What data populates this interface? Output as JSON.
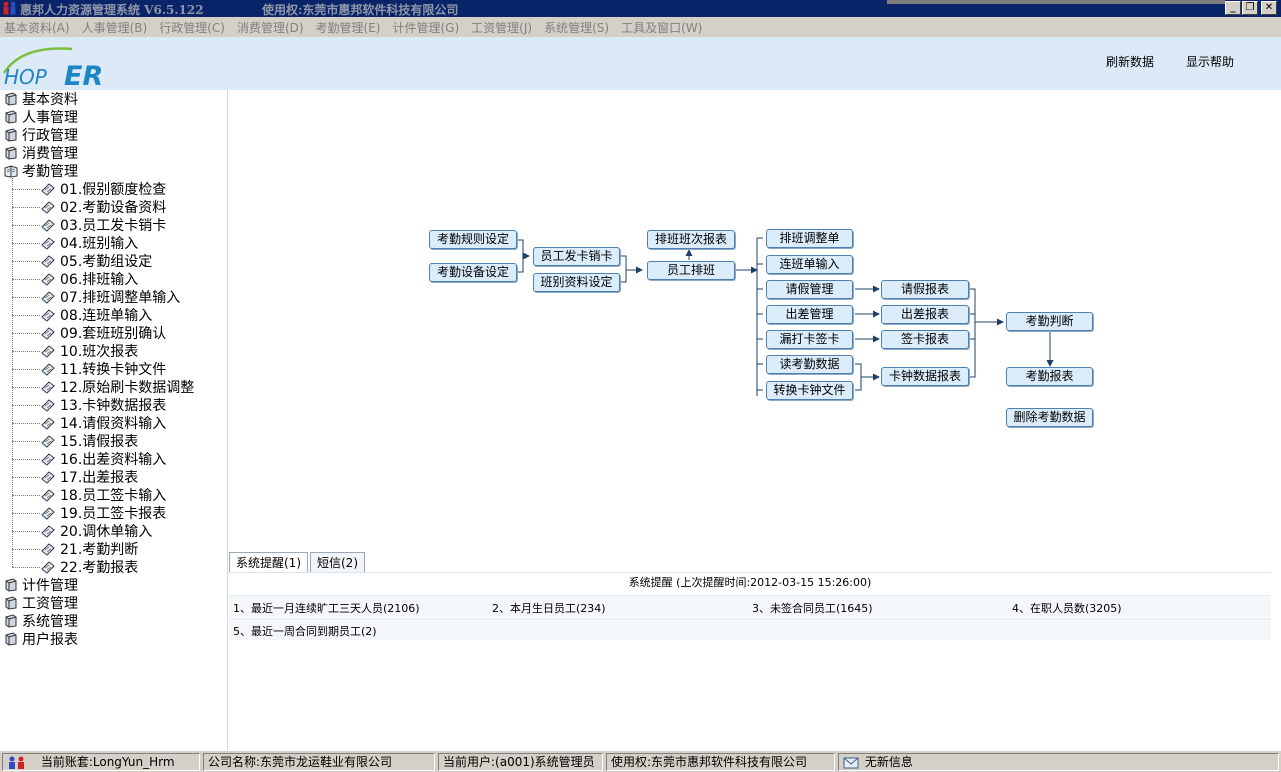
{
  "window": {
    "title": "惠邦人力资源管理系统 V6.5.122",
    "license": "使用权:东莞市惠邦软件科技有限公司",
    "minimize": "_",
    "restore": "❐",
    "close": "✕"
  },
  "menu": [
    "基本资料(A)",
    "人事管理(B)",
    "行政管理(C)",
    "消费管理(D)",
    "考勤管理(E)",
    "计件管理(G)",
    "工资管理(J)",
    "系统管理(S)",
    "工具及窗口(W)"
  ],
  "header": {
    "logo_text": "HOPER",
    "refresh": "刷新数据",
    "help": "显示帮助"
  },
  "sidebar": {
    "top": [
      "基本资料",
      "人事管理",
      "行政管理",
      "消费管理",
      "考勤管理"
    ],
    "children": [
      "01.假别额度检查",
      "02.考勤设备资料",
      "03.员工发卡销卡",
      "04.班别输入",
      "05.考勤组设定",
      "06.排班输入",
      "07.排班调整单输入",
      "08.连班单输入",
      "09.套班班别确认",
      "10.班次报表",
      "11.转换卡钟文件",
      "12.原始刷卡数据调整",
      "13.卡钟数据报表",
      "14.请假资料输入",
      "15.请假报表",
      "16.出差资料输入",
      "17.出差报表",
      "18.员工签卡输入",
      "19.员工签卡报表",
      "20.调休单输入",
      "21.考勤判断",
      "22.考勤报表"
    ],
    "bottom": [
      "计件管理",
      "工资管理",
      "系统管理",
      "用户报表"
    ]
  },
  "flow": {
    "rule_setting": "考勤规则设定",
    "device_setting": "考勤设备设定",
    "card_issue": "员工发卡销卡",
    "shift_setting": "班别资料设定",
    "shift_report": "排班班次报表",
    "scheduling": "员工排班",
    "schedule_adjust": "排班调整单",
    "consecutive_shift": "连班单输入",
    "leave_mgmt": "请假管理",
    "trip_mgmt": "出差管理",
    "missed_punch": "漏打卡签卡",
    "read_data": "读考勤数据",
    "convert_file": "转换卡钟文件",
    "leave_report": "请假报表",
    "trip_report": "出差报表",
    "sign_report": "签卡报表",
    "clock_report": "卡钟数据报表",
    "judge": "考勤判断",
    "att_report": "考勤报表",
    "delete_data": "删除考勤数据"
  },
  "tabs": [
    "系统提醒(1)",
    "短信(2)"
  ],
  "reminders": {
    "title": "系统提醒 (上次提醒时间:2012-03-15 15:26:00)",
    "row1": [
      "1、最近一月连续旷工三天人员(2106)",
      "2、本月生日员工(234)",
      "3、未签合同员工(1645)",
      "4、在职人员数(3205)"
    ],
    "row2": [
      "5、最近一周合同到期员工(2)"
    ]
  },
  "status": {
    "account": "当前账套:LongYun_Hrm",
    "company": "公司名称:东莞市龙运鞋业有限公司",
    "user": "当前用户:(a001)系统管理员",
    "license": "使用权:东莞市惠邦软件科技有限公司",
    "message": "无新信息"
  }
}
